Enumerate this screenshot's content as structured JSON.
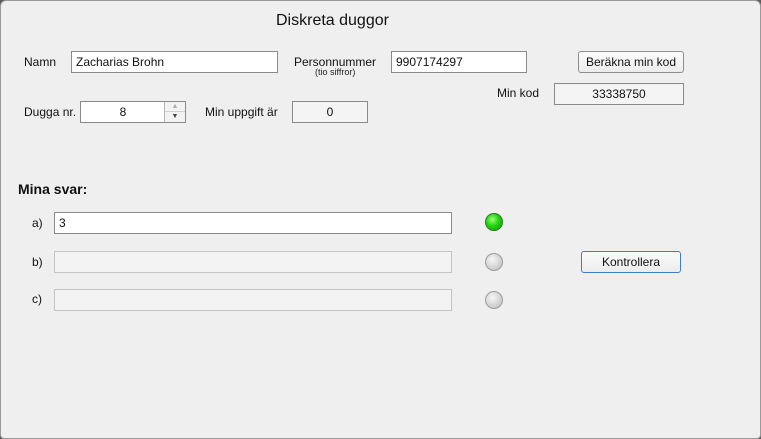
{
  "window": {
    "title": "Diskreta duggor"
  },
  "form": {
    "name_label": "Namn",
    "name_value": "Zacharias Brohn",
    "pnr_label": "Personnummer",
    "pnr_sublabel": "(tio siffror)",
    "pnr_value": "9907174297",
    "compute_button": "Beräkna min kod",
    "code_label": "Min kod",
    "code_value": "33338750",
    "dugga_label": "Dugga nr.",
    "dugga_value": "8",
    "task_label": "Min uppgift är",
    "task_value": "0"
  },
  "answers": {
    "heading": "Mina svar:",
    "rows": [
      {
        "label": "a)",
        "value": "3",
        "status": "correct"
      },
      {
        "label": "b)",
        "value": "",
        "status": "unchecked"
      },
      {
        "label": "c)",
        "value": "",
        "status": "unchecked"
      }
    ],
    "check_button": "Kontrollera"
  },
  "colors": {
    "lamp_correct": "#22d40f",
    "lamp_unchecked": "#d0d0d0",
    "focus_border": "#3b7fc9"
  }
}
